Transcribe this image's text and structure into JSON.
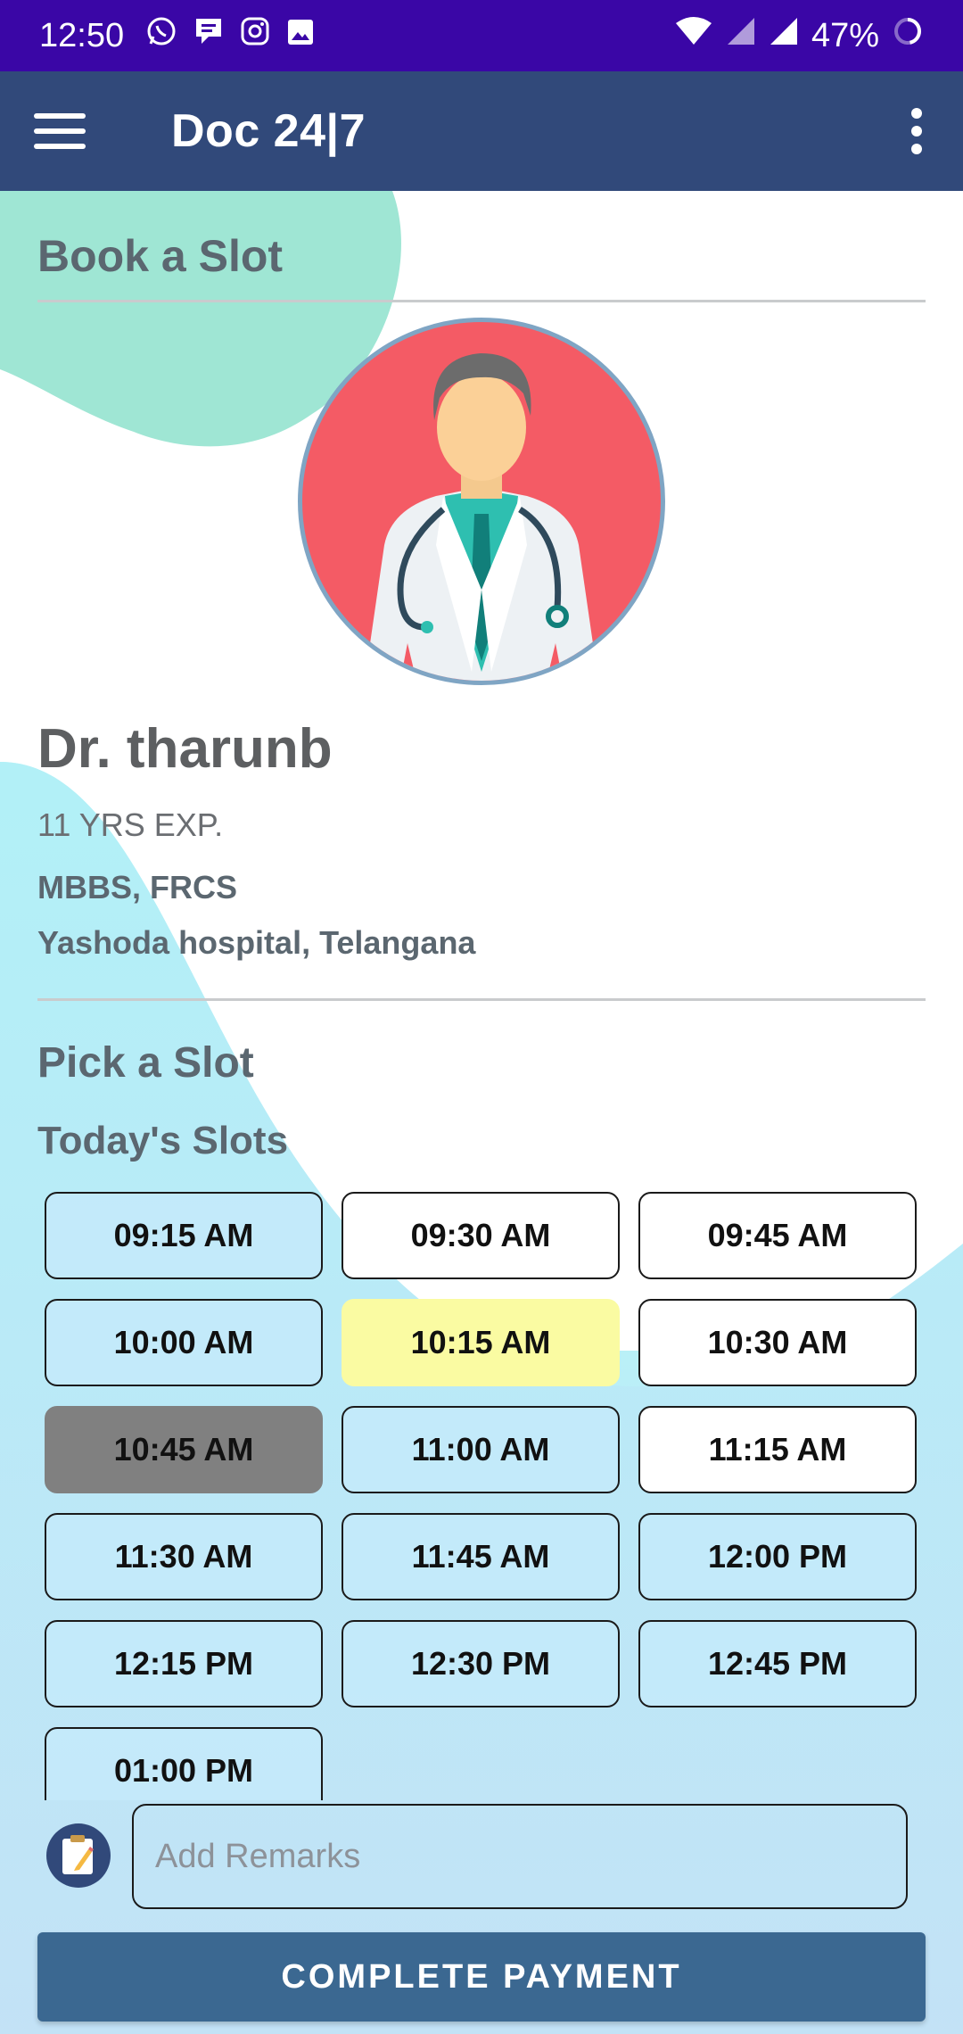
{
  "status_bar": {
    "time": "12:50",
    "battery": "47%",
    "notification_icons": [
      "whatsapp-icon",
      "message-icon",
      "instagram-icon",
      "gallery-icon"
    ]
  },
  "app_bar": {
    "title": "Doc 24|7"
  },
  "book_section": {
    "title": "Book a Slot"
  },
  "doctor": {
    "name": "Dr. tharunb",
    "experience": "11 YRS EXP.",
    "degrees": "MBBS, FRCS",
    "hospital": "Yashoda hospital, Telangana"
  },
  "pick_section": {
    "title": "Pick a Slot",
    "subtitle": "Today's Slots"
  },
  "slots": [
    {
      "label": "09:15 AM",
      "state": "available"
    },
    {
      "label": "09:30 AM",
      "state": "available"
    },
    {
      "label": "09:45 AM",
      "state": "available"
    },
    {
      "label": "10:00 AM",
      "state": "available"
    },
    {
      "label": "10:15 AM",
      "state": "selected"
    },
    {
      "label": "10:30 AM",
      "state": "available"
    },
    {
      "label": "10:45 AM",
      "state": "booked"
    },
    {
      "label": "11:00 AM",
      "state": "available"
    },
    {
      "label": "11:15 AM",
      "state": "available"
    },
    {
      "label": "11:30 AM",
      "state": "available"
    },
    {
      "label": "11:45 AM",
      "state": "available"
    },
    {
      "label": "12:00 PM",
      "state": "available"
    },
    {
      "label": "12:15 PM",
      "state": "available"
    },
    {
      "label": "12:30 PM",
      "state": "available"
    },
    {
      "label": "12:45 PM",
      "state": "available"
    },
    {
      "label": "01:00 PM",
      "state": "available"
    }
  ],
  "remarks": {
    "placeholder": "Add Remarks",
    "value": ""
  },
  "payment_button": {
    "label": "COMPLETE PAYMENT"
  },
  "colors": {
    "status_bar": "#3a06a6",
    "app_bar": "#31497a",
    "selected_slot": "#fafba2",
    "booked_slot": "#808080",
    "payment_button": "#3b6891"
  }
}
